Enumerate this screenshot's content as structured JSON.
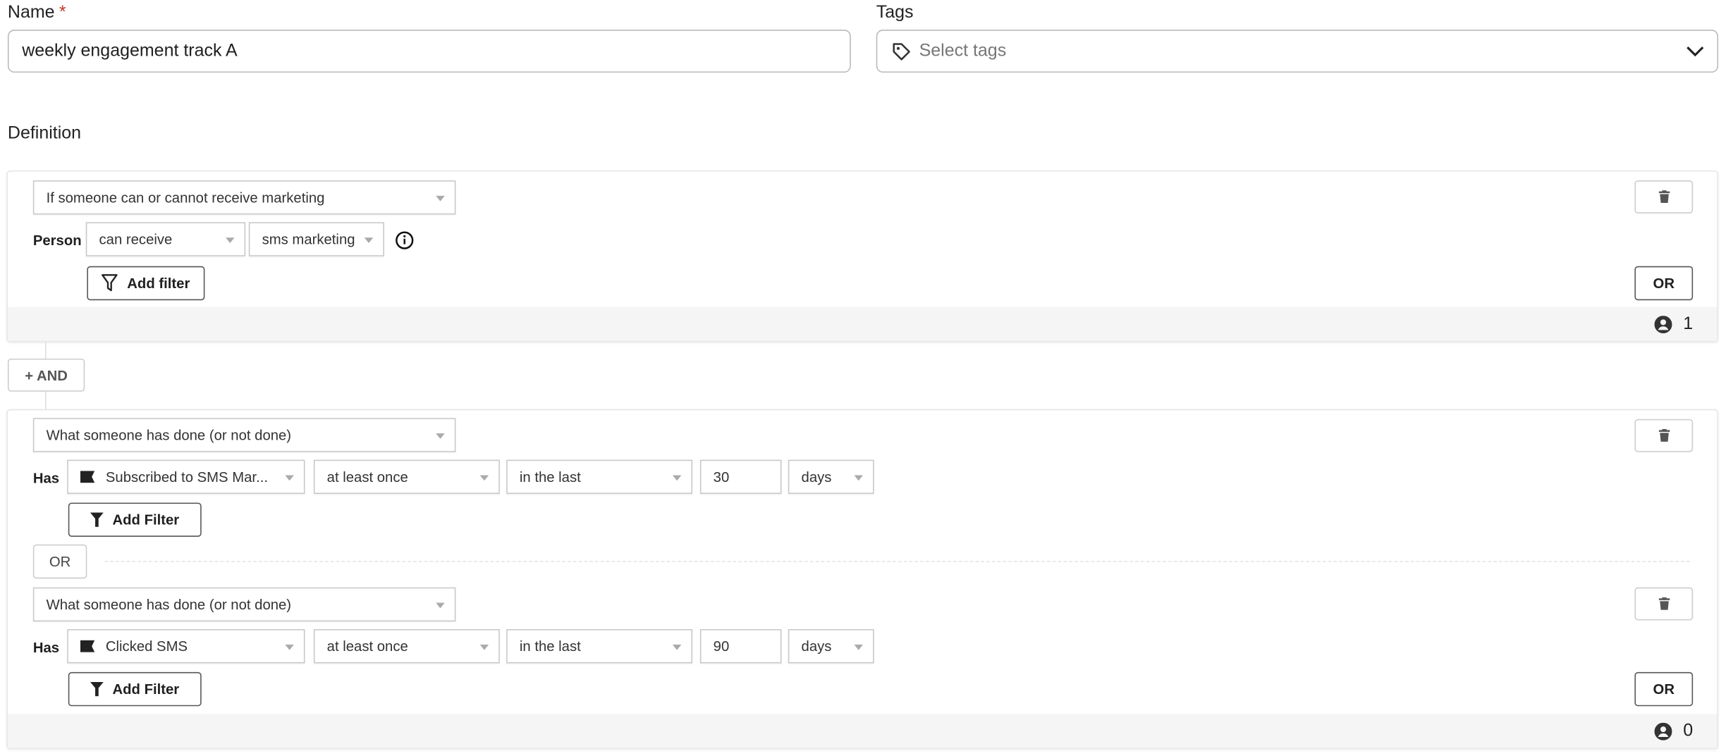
{
  "name_field": {
    "label": "Name",
    "required_mark": "*",
    "value": "weekly engagement track A"
  },
  "tags_field": {
    "label": "Tags",
    "placeholder": "Select tags",
    "icon": "tag-icon"
  },
  "definition": {
    "label": "Definition"
  },
  "group1": {
    "condition_type": "If someone can or cannot receive marketing",
    "row_label": "Person",
    "status": "can receive",
    "channel": "sms marketing",
    "add_filter_label": "Add filter",
    "or_label": "OR",
    "count": "1"
  },
  "and_button": {
    "label": "+ AND"
  },
  "group2": {
    "conditions": [
      {
        "condition_type": "What someone has done (or not done)",
        "row_label": "Has",
        "metric": "Subscribed to SMS Mar...",
        "frequency": "at least once",
        "timeframe": "in the last",
        "amount": "30",
        "unit": "days",
        "add_filter_label": "Add Filter"
      },
      {
        "condition_type": "What someone has done (or not done)",
        "row_label": "Has",
        "metric": "Clicked SMS",
        "frequency": "at least once",
        "timeframe": "in the last",
        "amount": "90",
        "unit": "days",
        "add_filter_label": "Add Filter"
      }
    ],
    "or_separator": "OR",
    "or_label": "OR",
    "count": "0"
  }
}
